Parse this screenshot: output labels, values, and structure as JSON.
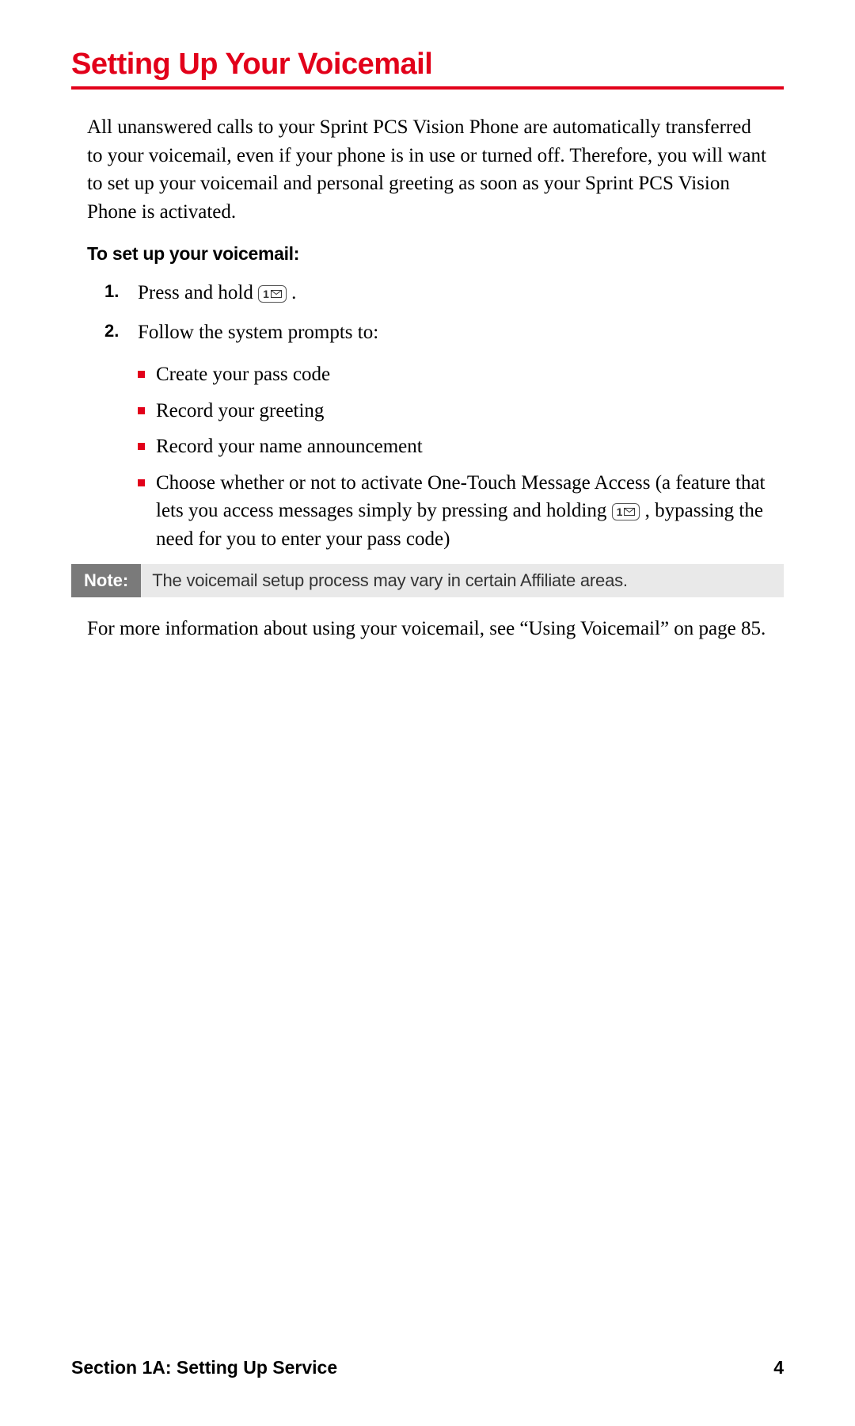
{
  "heading": "Setting Up Your Voicemail",
  "intro": "All unanswered calls to your Sprint PCS Vision Phone are automatically transferred to your voicemail, even if your phone is in use or turned off. Therefore, you will want to set up your voicemail and personal greeting as soon as your Sprint PCS Vision Phone is activated.",
  "subhead": "To set up your voicemail:",
  "steps": [
    {
      "num": "1.",
      "text_before": "Press and hold ",
      "keyDigit": "1",
      "text_after": "."
    },
    {
      "num": "2.",
      "text_before": "Follow the system prompts to:"
    }
  ],
  "bullets": [
    {
      "text": "Create your pass code"
    },
    {
      "text": "Record your greeting"
    },
    {
      "text": "Record your name announcement"
    },
    {
      "text_before": "Choose whether or not to activate One-Touch Message Access (a feature that lets you access messages simply by pressing and holding ",
      "keyDigit": "1",
      "text_after": ", bypassing the need for you to enter your pass code)"
    }
  ],
  "note": {
    "label": "Note:",
    "body": "The voicemail setup process may vary in certain Affiliate areas."
  },
  "followup": "For more information about using your voicemail, see “Using Voicemail” on page 85.",
  "footer": {
    "section": "Section 1A: Setting Up Service",
    "page": "4"
  }
}
